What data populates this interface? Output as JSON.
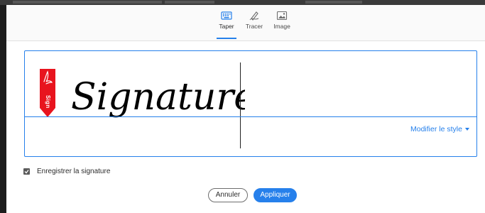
{
  "tabs": [
    {
      "label": "Taper",
      "icon": "keyboard-icon",
      "active": true
    },
    {
      "label": "Tracer",
      "icon": "pen-draw-icon",
      "active": false
    },
    {
      "label": "Image",
      "icon": "image-icon",
      "active": false
    }
  ],
  "signature": {
    "text": "Signature",
    "badge_label": "Sign",
    "modify_style_label": "Modifier le style"
  },
  "save_option": {
    "label": "Enregistrer la signature",
    "checked": true
  },
  "buttons": {
    "cancel_label": "Annuler",
    "apply_label": "Appliquer"
  },
  "colors": {
    "accent": "#2680eb",
    "badge": "#e8141e",
    "text": "#2c2c2c"
  }
}
